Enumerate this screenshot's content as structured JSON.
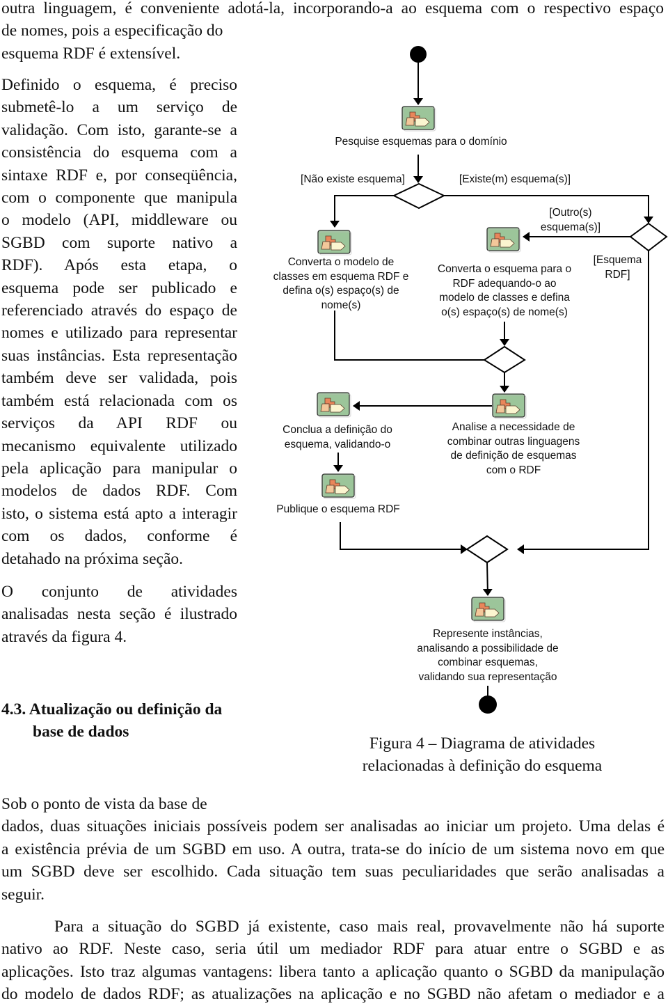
{
  "intro": {
    "lines": [
      "outra linguagem, é conveniente adotá-la, incorporando-a ao esquema com o respectivo espaço",
      "de nomes, pois a especificação do",
      "esquema RDF é extensível."
    ]
  },
  "left_column": {
    "paragraph1": [
      "Definido o esquema, é preciso",
      "submetê-lo a um serviço de",
      "validação. Com isto, garante-se a",
      "consistência do esquema com a",
      "sintaxe RDF e, por conseqüência,",
      "com o componente que manipula",
      "o modelo (API, middleware ou",
      "SGBD com suporte nativo a",
      "RDF). Após esta etapa, o",
      "esquema pode ser publicado e",
      "referenciado através do espaço de",
      "nomes e utilizado para representar",
      "suas instâncias. Esta representação",
      "também deve ser validada, pois",
      "também está relacionada com os",
      "serviços da API RDF ou",
      "mecanismo equivalente utilizado",
      "pela aplicação para manipular o",
      "modelos de dados RDF. Com",
      "isto, o sistema está apto a interagir",
      "com os dados, conforme é",
      "detahado na próxima seção."
    ],
    "paragraph2": [
      "O conjunto de atividades",
      "analisadas nesta seção é ilustrado",
      "através da figura 4."
    ],
    "section_heading": {
      "number": "4.3.",
      "line1": "Atualização ou definição da",
      "line2": "base de dados"
    }
  },
  "diagram": {
    "activities": {
      "search": "Pesquise esquemas para o domínio",
      "convert_model": [
        "Converta o modelo de",
        "classes em esquema RDF e",
        "defina o(s) espaço(s) de",
        "nome(s)"
      ],
      "convert_schema": [
        "Converta o esquema para o",
        "RDF adequando-o ao",
        "modelo de classes e defina",
        "o(s) espaço(s) de nome(s)"
      ],
      "conclude": [
        "Conclua a definição do",
        "esquema, validando-o"
      ],
      "analyse": [
        "Analise a necessidade de",
        "combinar outras linguagens",
        "de definição de esquemas",
        "com o RDF"
      ],
      "publish": "Publique o esquema RDF",
      "represent": [
        "Represente instâncias,",
        "analisando a possibilidade de",
        "combinar esquemas,",
        "validando sua representação"
      ]
    },
    "guards": {
      "no_schema": "[Não existe esquema]",
      "exists_schema": "[Existe(m) esquema(s)]",
      "other_schema": [
        "[Outro(s)",
        "esquema(s)]"
      ],
      "rdf_schema": [
        "[Esquema",
        "RDF]"
      ]
    },
    "icon": "activity-icon",
    "colors": {
      "activity_fill": "#9cc59a",
      "shape_orange": "#e9865a",
      "shape_peach": "#f3c79a",
      "shape_cream": "#fbf5d0",
      "stroke": "#000000"
    }
  },
  "figure_caption": [
    "Figura 4 – Diagrama de atividades",
    "relacionadas à definição do esquema"
  ],
  "body_after": {
    "paragraph1": [
      "Sob o ponto de vista da base de",
      "dados, duas situações iniciais possíveis podem ser analisadas ao iniciar um projeto. Uma delas é",
      "a existência prévia de um SGBD em uso. A outra, trata-se do início de um sistema novo em que",
      "um SGBD deve ser escolhido. Cada situação tem suas peculiaridades que serão analisadas a",
      "seguir."
    ],
    "paragraph2": [
      "Para a situação do SGBD já existente, caso mais real, provavelmente não há suporte",
      "nativo ao RDF. Neste caso, seria útil um mediador RDF para atuar entre o SGBD e as",
      "aplicações. Isto traz algumas vantagens: libera tanto a aplicação quanto o SGBD da manipulação",
      "do modelo de dados RDF; as atualizações na aplicação e no SGBD não afetam o mediador e a"
    ]
  }
}
